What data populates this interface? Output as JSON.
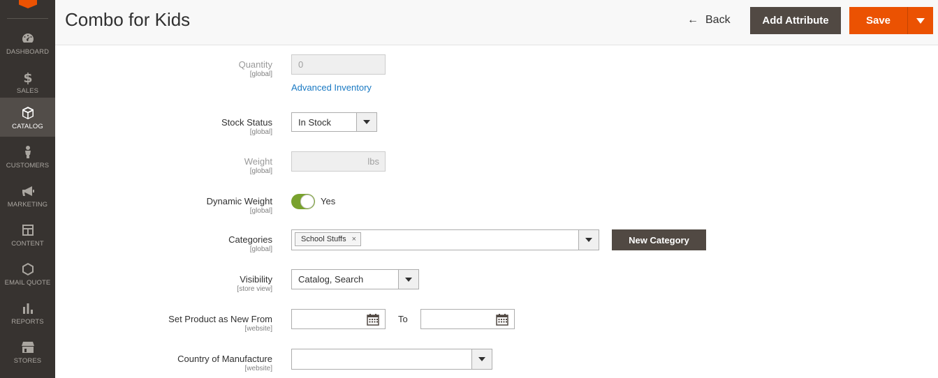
{
  "sidebar": {
    "items": [
      {
        "label": "Dashboard",
        "icon": "dashboard-icon"
      },
      {
        "label": "Sales",
        "icon": "dollar-icon"
      },
      {
        "label": "Catalog",
        "icon": "box-icon",
        "active": true
      },
      {
        "label": "Customers",
        "icon": "person-icon"
      },
      {
        "label": "Marketing",
        "icon": "megaphone-icon"
      },
      {
        "label": "Content",
        "icon": "layout-icon"
      },
      {
        "label": "Email Quote",
        "icon": "hexagon-icon"
      },
      {
        "label": "Reports",
        "icon": "bar-chart-icon"
      },
      {
        "label": "Stores",
        "icon": "store-icon"
      }
    ]
  },
  "header": {
    "title": "Combo for Kids",
    "back_label": "Back",
    "add_attribute_label": "Add Attribute",
    "save_label": "Save"
  },
  "form": {
    "quantity": {
      "label": "Quantity",
      "scope": "[global]",
      "value": "0",
      "link": "Advanced Inventory"
    },
    "stock_status": {
      "label": "Stock Status",
      "scope": "[global]",
      "value": "In Stock"
    },
    "weight": {
      "label": "Weight",
      "scope": "[global]",
      "unit": "lbs"
    },
    "dynamic_weight": {
      "label": "Dynamic Weight",
      "scope": "[global]",
      "value": "Yes"
    },
    "categories": {
      "label": "Categories",
      "scope": "[global]",
      "tag": "School Stuffs",
      "tag_remove": "×",
      "new_button": "New Category"
    },
    "visibility": {
      "label": "Visibility",
      "scope": "[store view]",
      "value": "Catalog, Search"
    },
    "new_from": {
      "label": "Set Product as New From",
      "scope": "[website]",
      "to_label": "To"
    },
    "country": {
      "label": "Country of Manufacture",
      "scope": "[website]",
      "value": ""
    }
  },
  "colors": {
    "accent": "#eb5202",
    "sidebar_bg": "#373330",
    "dark_button": "#514943",
    "link": "#1979c3",
    "toggle_on": "#79a22e"
  }
}
